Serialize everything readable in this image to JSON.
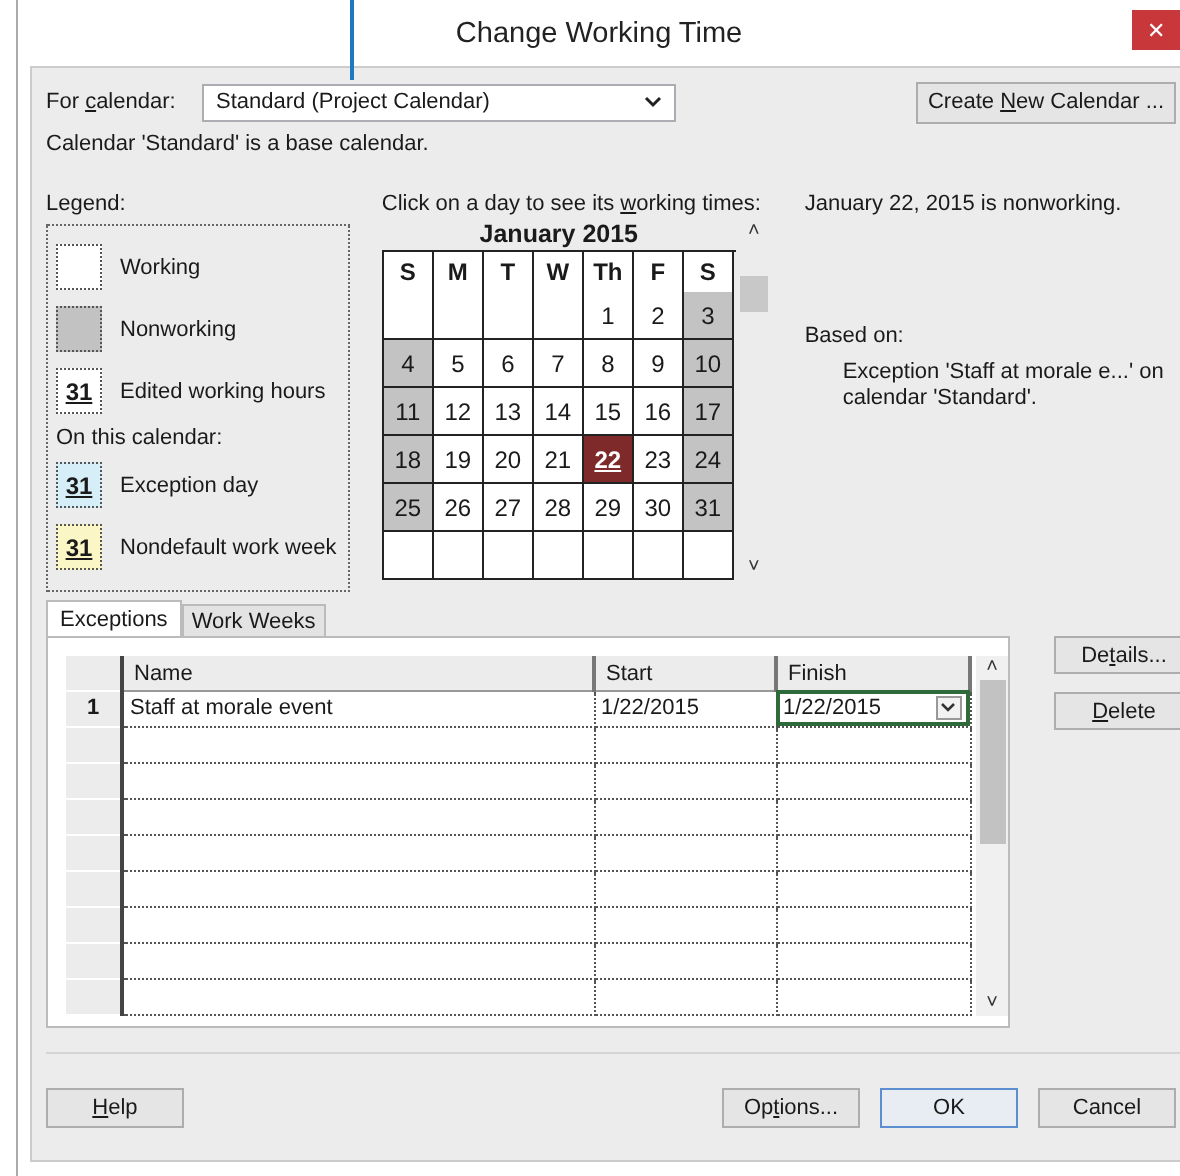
{
  "window": {
    "title": "Change Working Time",
    "close": "✕"
  },
  "for_calendar": {
    "label_parts": [
      "For ",
      "c",
      "alendar:"
    ],
    "value": "Standard (Project Calendar)"
  },
  "create_button": {
    "label_parts": [
      "Create ",
      "N",
      "ew Calendar ..."
    ]
  },
  "base_note": "Calendar 'Standard' is a base calendar.",
  "legend": {
    "title": "Legend:",
    "subtitle": "On this calendar:",
    "items": [
      {
        "kind": "working",
        "label": "Working"
      },
      {
        "kind": "nonworking",
        "label": "Nonworking"
      },
      {
        "kind": "edited",
        "label": "Edited working hours",
        "mark": "31"
      }
    ],
    "calendar_items": [
      {
        "kind": "exception",
        "label": "Exception day",
        "mark": "31"
      },
      {
        "kind": "nondefault",
        "label": "Nondefault work week",
        "mark": "31"
      }
    ]
  },
  "calendar": {
    "prompt_parts": [
      "Click on a day to see its ",
      "w",
      "orking times:"
    ],
    "month": "January 2015",
    "scroll_up": "˄",
    "scroll_down": "˅",
    "weekdays": [
      "S",
      "M",
      "T",
      "W",
      "Th",
      "F",
      "S"
    ],
    "weeks": [
      [
        {
          "kind": "blank"
        },
        {
          "kind": "blank"
        },
        {
          "kind": "blank"
        },
        {
          "kind": "blank"
        },
        {
          "kind": "working",
          "day": "1",
          "selected": false
        },
        {
          "kind": "working",
          "day": "2",
          "selected": false
        },
        {
          "kind": "nonworking",
          "day": "3",
          "selected": false
        }
      ],
      [
        {
          "kind": "nonworking",
          "day": "4",
          "selected": false
        },
        {
          "kind": "working",
          "day": "5",
          "selected": false
        },
        {
          "kind": "working",
          "day": "6",
          "selected": false
        },
        {
          "kind": "working",
          "day": "7",
          "selected": false
        },
        {
          "kind": "working",
          "day": "8",
          "selected": false
        },
        {
          "kind": "working",
          "day": "9",
          "selected": false
        },
        {
          "kind": "nonworking",
          "day": "10",
          "selected": false
        }
      ],
      [
        {
          "kind": "nonworking",
          "day": "11",
          "selected": false
        },
        {
          "kind": "working",
          "day": "12",
          "selected": false
        },
        {
          "kind": "working",
          "day": "13",
          "selected": false
        },
        {
          "kind": "working",
          "day": "14",
          "selected": false
        },
        {
          "kind": "working",
          "day": "15",
          "selected": false
        },
        {
          "kind": "working",
          "day": "16",
          "selected": false
        },
        {
          "kind": "nonworking",
          "day": "17",
          "selected": false
        }
      ],
      [
        {
          "kind": "nonworking",
          "day": "18",
          "selected": false
        },
        {
          "kind": "working",
          "day": "19",
          "selected": false
        },
        {
          "kind": "working",
          "day": "20",
          "selected": false
        },
        {
          "kind": "working",
          "day": "21",
          "selected": false
        },
        {
          "kind": "exception",
          "day": "22",
          "selected": true
        },
        {
          "kind": "working",
          "day": "23",
          "selected": false
        },
        {
          "kind": "nonworking",
          "day": "24",
          "selected": false
        }
      ],
      [
        {
          "kind": "nonworking",
          "day": "25",
          "selected": false
        },
        {
          "kind": "working",
          "day": "26",
          "selected": false
        },
        {
          "kind": "working",
          "day": "27",
          "selected": false
        },
        {
          "kind": "working",
          "day": "28",
          "selected": false
        },
        {
          "kind": "working",
          "day": "29",
          "selected": false
        },
        {
          "kind": "working",
          "day": "30",
          "selected": false
        },
        {
          "kind": "nonworking",
          "day": "31",
          "selected": false
        }
      ],
      [
        {
          "kind": "blank"
        },
        {
          "kind": "blank"
        },
        {
          "kind": "blank"
        },
        {
          "kind": "blank"
        },
        {
          "kind": "blank"
        },
        {
          "kind": "blank"
        },
        {
          "kind": "blank"
        }
      ]
    ]
  },
  "status": {
    "headline": "January 22, 2015 is nonworking.",
    "based_on": "Based on:",
    "detail": "Exception 'Staff at morale e...' on calendar 'Standard'."
  },
  "tabs": [
    {
      "label": "Exceptions",
      "selected": true
    },
    {
      "label": "Work Weeks",
      "selected": false
    }
  ],
  "table": {
    "columns": [
      "Name",
      "Start",
      "Finish"
    ],
    "rows": [
      {
        "num": "1",
        "name": "Staff at morale event",
        "start": "1/22/2015",
        "finish": "1/22/2015",
        "finish_editing": true
      }
    ],
    "scroll_up": "˄",
    "scroll_down": "˅"
  },
  "side_buttons": [
    {
      "label": {
        "before": "De",
        "key": "t",
        "after": "ails..."
      }
    },
    {
      "label": {
        "key": "D",
        "after": "elete"
      }
    }
  ],
  "footer_buttons": [
    {
      "kind": "help",
      "label": {
        "key": "H",
        "after": "elp"
      },
      "default": false
    },
    {
      "kind": "options",
      "label": {
        "before": "Op",
        "key": "t",
        "after": "ions..."
      },
      "default": false
    },
    {
      "kind": "ok",
      "label": {
        "before": "OK"
      },
      "default": true
    },
    {
      "kind": "cancel",
      "label": {
        "before": "Cancel"
      },
      "default": false
    }
  ]
}
